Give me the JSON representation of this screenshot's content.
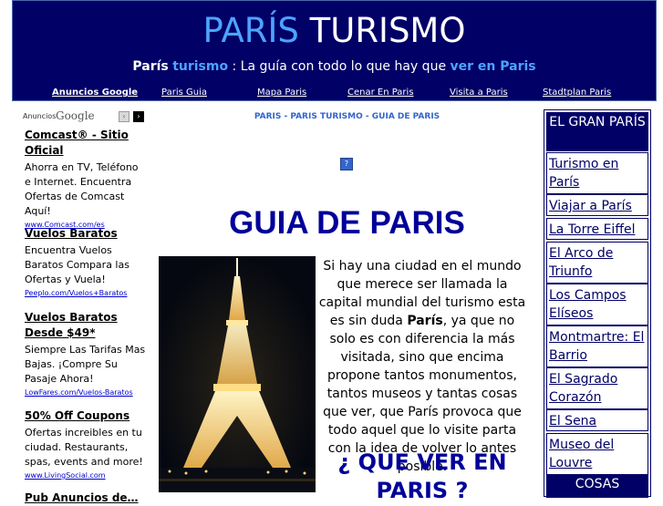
{
  "header": {
    "title_part1": "PARÍS",
    "title_part2": "TURISMO",
    "tagline_1": "París",
    "tagline_2": "turismo",
    "tagline_3": " : La guía con todo lo que hay que ",
    "tagline_4": "ver en Paris"
  },
  "nav": {
    "items": [
      "Anuncios Google",
      "Paris Guia",
      "Mapa Paris",
      "Cenar En Paris",
      "Visita a Paris",
      "Stadtplan Paris"
    ]
  },
  "ads": {
    "label": "Anuncios",
    "google_word": "Google",
    "prev_icon": "‹",
    "next_icon": "›",
    "items": [
      {
        "title": "Comcast® - Sitio Oficial",
        "body": "Ahorra en TV, Teléfono e Internet. Encuentra Ofertas de Comcast Aquí!",
        "url": "www.Comcast.com/es"
      },
      {
        "title": "Vuelos Baratos",
        "body": "Encuentra Vuelos Baratos Compara las Ofertas y Vuela!",
        "url": "Peeplo.com/Vuelos+Baratos"
      },
      {
        "title": "Vuelos Baratos Desde $49*",
        "body": "Siempre Las Tarifas Mas Bajas. ¡Compre Su Pasaje Ahora!",
        "url": "LowFares.com/Vuelos-Baratos"
      },
      {
        "title": "50% Off Coupons",
        "body": "Ofertas increibles en tu ciudad. Restaurants, spas, events and more!",
        "url": "www.LivingSocial.com"
      },
      {
        "title": "Pub Anuncios de…",
        "body": "",
        "url": ""
      }
    ]
  },
  "main": {
    "breadcrumb": "PARIS - PARIS TURISMO - GUIA DE PARIS",
    "help_icon": "?",
    "heading": "GUIA DE PARIS",
    "photo_alt": "Torre Eiffel de noche",
    "intro_1": "Si hay una ciudad en el mundo que merece ser llamada la capital mundial del turismo esta es sin duda ",
    "intro_bold": "París",
    "intro_2": ", ya que no solo es con diferencia la más visitada, sino que encima propone tantos monumentos, tantos museos y tantas cosas que ver, que París provoca que todo aquel que lo visite parta con la idea de volver lo antes posible.",
    "subheading": "¿ QUE VER EN PARIS ?"
  },
  "sidebar": {
    "heading": "EL GRAN PARÍS",
    "links": [
      "Turismo en París",
      "Viajar a París",
      "La Torre Eiffel",
      "El Arco de Triunfo",
      "Los Campos Elíseos",
      "Montmartre: El Barrio",
      "El Sagrado Corazón",
      "El Sena",
      "Museo del Louvre"
    ],
    "heading2": "COSAS"
  },
  "colors": {
    "header_bg": "#000066",
    "accent_blue": "#4da3ff",
    "heading_blue": "#000099"
  }
}
